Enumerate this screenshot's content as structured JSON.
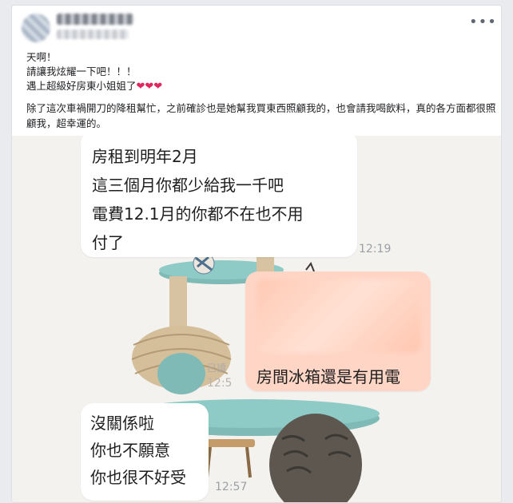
{
  "post": {
    "author_name": "",
    "more_icon": "more-horizontal-icon",
    "more_label": "•••",
    "lines": [
      "天啊！",
      "請讓我炫耀一下吧！！！",
      "遇上超級好房東小姐姐了"
    ],
    "hearts": "❤❤❤",
    "paragraph": "除了這次車禍開刀的降租幫忙，之前確診也是她幫我買東西照顧我的，也會請我喝飲料，真的各方面都很照顧我，超幸運的。"
  },
  "chat": {
    "bubble1": {
      "lines": [
        "房租到明年2月",
        "這三個月你都少給我一千吧",
        "電費12.1月的你都不在也不用",
        "付了"
      ],
      "time": "12:19"
    },
    "bubble2": {
      "line": "房間冰箱還是有用電",
      "read": "已讀",
      "time": "12:5"
    },
    "bubble3": {
      "lines": [
        "沒關係啦",
        "你也不願意",
        "你也很不好受"
      ],
      "time": "12:57"
    }
  },
  "colors": {
    "page_bg": "#e9ebee",
    "card_bg": "#ffffff",
    "chat_bg": "#f4f2ef",
    "outgoing_bubble": "#ffd6c6",
    "heart": "#e0245e",
    "cat_tree_teal": "#6fb1ad",
    "cat_tree_wood": "#d9c7a8"
  }
}
